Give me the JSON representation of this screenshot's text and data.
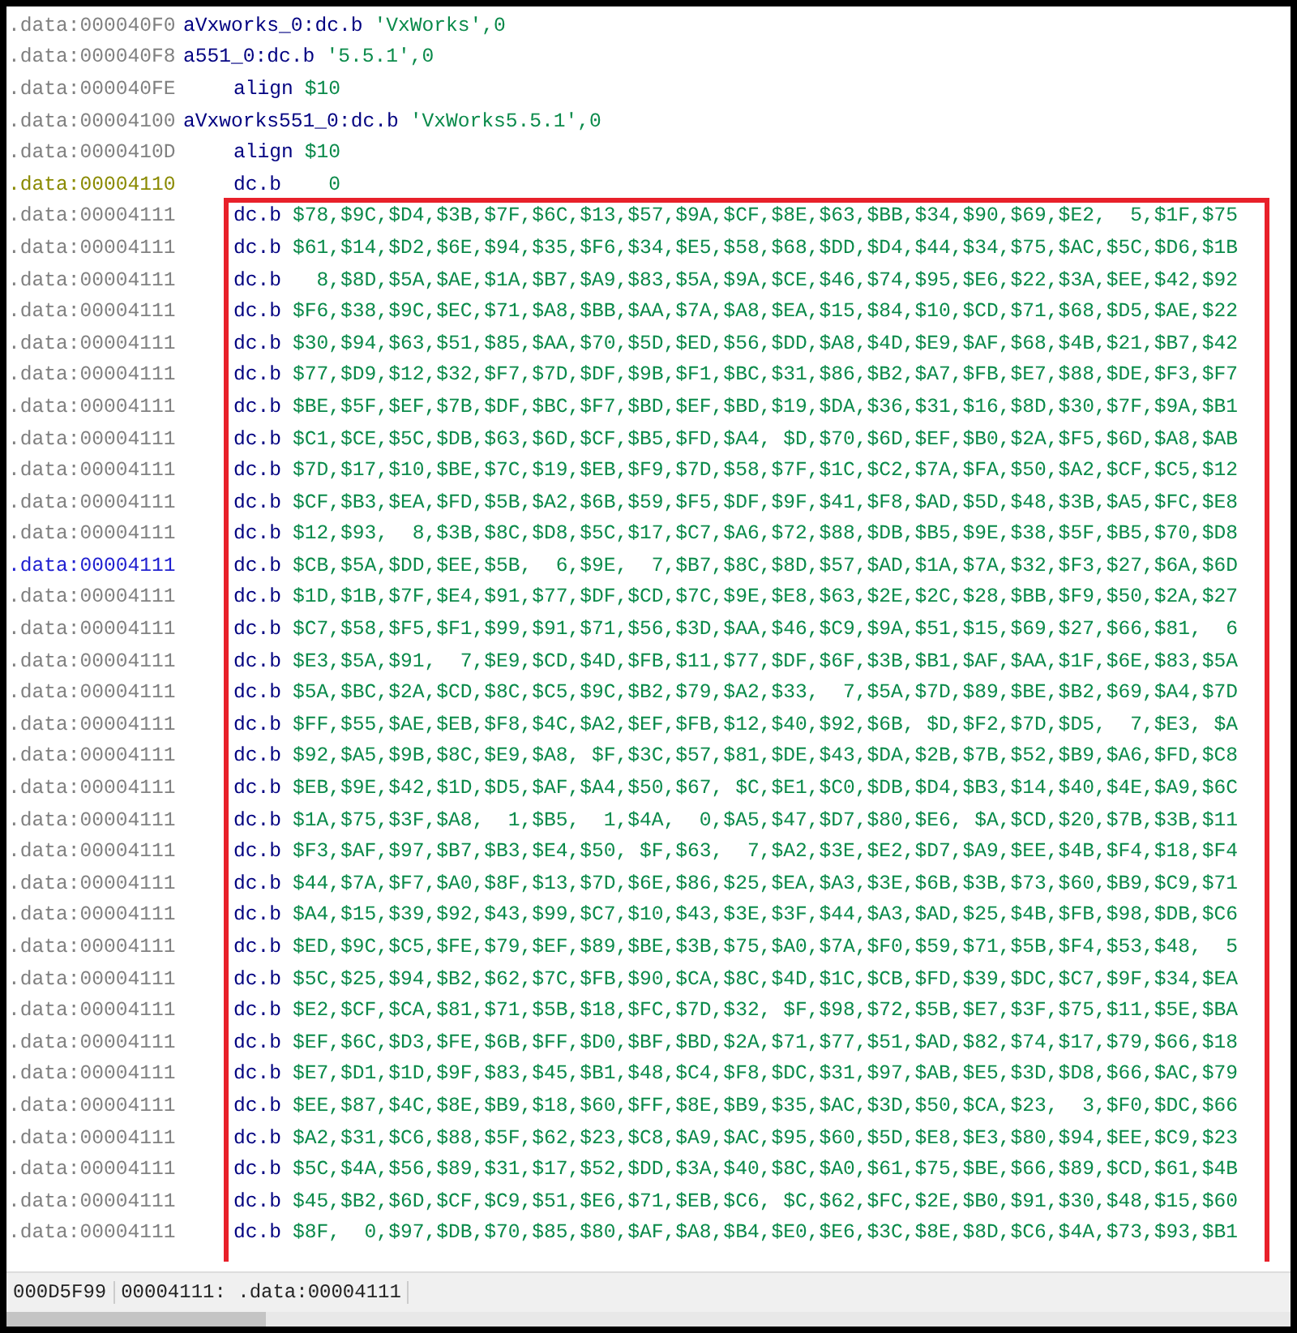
{
  "listing": [
    {
      "address": ".data:000040F0",
      "color": "#808080",
      "label": "aVxworks_0:",
      "mnemonic": "dc.b",
      "operand": "'VxWorks',0"
    },
    {
      "address": ".data:000040F8",
      "color": "#808080",
      "label": "a551_0:",
      "mnemonic": "dc.b",
      "operand": "'5.5.1',0"
    },
    {
      "address": ".data:000040FE",
      "color": "#808080",
      "mnemonic": "align",
      "operand": "$10"
    },
    {
      "address": ".data:00004100",
      "color": "#808080",
      "label": "aVxworks551_0:",
      "mnemonic": "dc.b",
      "operand": "'VxWorks5.5.1',0"
    },
    {
      "address": ".data:0000410D",
      "color": "#808080",
      "mnemonic": "align",
      "operand": "$10"
    },
    {
      "address": ".data:00004110",
      "color": "#8a8a00",
      "mnemonic": "dc.b",
      "operand": "   0"
    },
    {
      "address": ".data:00004111",
      "color": "#808080",
      "mnemonic": "dc.b",
      "operand": "$78,$9C,$D4,$3B,$7F,$6C,$13,$57,$9A,$CF,$8E,$63,$BB,$34,$90,$69,$E2,  5,$1F,$75"
    },
    {
      "address": ".data:00004111",
      "color": "#808080",
      "mnemonic": "dc.b",
      "operand": "$61,$14,$D2,$6E,$94,$35,$F6,$34,$E5,$58,$68,$DD,$D4,$44,$34,$75,$AC,$5C,$D6,$1B"
    },
    {
      "address": ".data:00004111",
      "color": "#808080",
      "mnemonic": "dc.b",
      "operand": "  8,$8D,$5A,$AE,$1A,$B7,$A9,$83,$5A,$9A,$CE,$46,$74,$95,$E6,$22,$3A,$EE,$42,$92"
    },
    {
      "address": ".data:00004111",
      "color": "#808080",
      "mnemonic": "dc.b",
      "operand": "$F6,$38,$9C,$EC,$71,$A8,$BB,$AA,$7A,$A8,$EA,$15,$84,$10,$CD,$71,$68,$D5,$AE,$22"
    },
    {
      "address": ".data:00004111",
      "color": "#808080",
      "mnemonic": "dc.b",
      "operand": "$30,$94,$63,$51,$85,$AA,$70,$5D,$ED,$56,$DD,$A8,$4D,$E9,$AF,$68,$4B,$21,$B7,$42"
    },
    {
      "address": ".data:00004111",
      "color": "#808080",
      "mnemonic": "dc.b",
      "operand": "$77,$D9,$12,$32,$F7,$7D,$DF,$9B,$F1,$BC,$31,$86,$B2,$A7,$FB,$E7,$88,$DE,$F3,$F7"
    },
    {
      "address": ".data:00004111",
      "color": "#808080",
      "mnemonic": "dc.b",
      "operand": "$BE,$5F,$EF,$7B,$DF,$BC,$F7,$BD,$EF,$BD,$19,$DA,$36,$31,$16,$8D,$30,$7F,$9A,$B1"
    },
    {
      "address": ".data:00004111",
      "color": "#808080",
      "mnemonic": "dc.b",
      "operand": "$C1,$CE,$5C,$DB,$63,$6D,$CF,$B5,$FD,$A4, $D,$70,$6D,$EF,$B0,$2A,$F5,$6D,$A8,$AB"
    },
    {
      "address": ".data:00004111",
      "color": "#808080",
      "mnemonic": "dc.b",
      "operand": "$7D,$17,$10,$BE,$7C,$19,$EB,$F9,$7D,$58,$7F,$1C,$C2,$7A,$FA,$50,$A2,$CF,$C5,$12"
    },
    {
      "address": ".data:00004111",
      "color": "#808080",
      "mnemonic": "dc.b",
      "operand": "$CF,$B3,$EA,$FD,$5B,$A2,$6B,$59,$F5,$DF,$9F,$41,$F8,$AD,$5D,$48,$3B,$A5,$FC,$E8"
    },
    {
      "address": ".data:00004111",
      "color": "#808080",
      "mnemonic": "dc.b",
      "operand": "$12,$93,  8,$3B,$8C,$D8,$5C,$17,$C7,$A6,$72,$88,$DB,$B5,$9E,$38,$5F,$B5,$70,$D8"
    },
    {
      "address": ".data:00004111",
      "color": "#2020d0",
      "mnemonic": "dc.b",
      "operand": "$CB,$5A,$DD,$EE,$5B,  6,$9E,  7,$B7,$8C,$8D,$57,$AD,$1A,$7A,$32,$F3,$27,$6A,$6D"
    },
    {
      "address": ".data:00004111",
      "color": "#808080",
      "mnemonic": "dc.b",
      "operand": "$1D,$1B,$7F,$E4,$91,$77,$DF,$CD,$7C,$9E,$E8,$63,$2E,$2C,$28,$BB,$F9,$50,$2A,$27"
    },
    {
      "address": ".data:00004111",
      "color": "#808080",
      "mnemonic": "dc.b",
      "operand": "$C7,$58,$F5,$F1,$99,$91,$71,$56,$3D,$AA,$46,$C9,$9A,$51,$15,$69,$27,$66,$81,  6"
    },
    {
      "address": ".data:00004111",
      "color": "#808080",
      "mnemonic": "dc.b",
      "operand": "$E3,$5A,$91,  7,$E9,$CD,$4D,$FB,$11,$77,$DF,$6F,$3B,$B1,$AF,$AA,$1F,$6E,$83,$5A"
    },
    {
      "address": ".data:00004111",
      "color": "#808080",
      "mnemonic": "dc.b",
      "operand": "$5A,$BC,$2A,$CD,$8C,$C5,$9C,$B2,$79,$A2,$33,  7,$5A,$7D,$89,$BE,$B2,$69,$A4,$7D"
    },
    {
      "address": ".data:00004111",
      "color": "#808080",
      "mnemonic": "dc.b",
      "operand": "$FF,$55,$AE,$EB,$F8,$4C,$A2,$EF,$FB,$12,$40,$92,$6B, $D,$F2,$7D,$D5,  7,$E3, $A"
    },
    {
      "address": ".data:00004111",
      "color": "#808080",
      "mnemonic": "dc.b",
      "operand": "$92,$A5,$9B,$8C,$E9,$A8, $F,$3C,$57,$81,$DE,$43,$DA,$2B,$7B,$52,$B9,$A6,$FD,$C8"
    },
    {
      "address": ".data:00004111",
      "color": "#808080",
      "mnemonic": "dc.b",
      "operand": "$EB,$9E,$42,$1D,$D5,$AF,$A4,$50,$67, $C,$E1,$C0,$DB,$D4,$B3,$14,$40,$4E,$A9,$6C"
    },
    {
      "address": ".data:00004111",
      "color": "#808080",
      "mnemonic": "dc.b",
      "operand": "$1A,$75,$3F,$A8,  1,$B5,  1,$4A,  0,$A5,$47,$D7,$80,$E6, $A,$CD,$20,$7B,$3B,$11"
    },
    {
      "address": ".data:00004111",
      "color": "#808080",
      "mnemonic": "dc.b",
      "operand": "$F3,$AF,$97,$B7,$B3,$E4,$50, $F,$63,  7,$A2,$3E,$E2,$D7,$A9,$EE,$4B,$F4,$18,$F4"
    },
    {
      "address": ".data:00004111",
      "color": "#808080",
      "mnemonic": "dc.b",
      "operand": "$44,$7A,$F7,$A0,$8F,$13,$7D,$6E,$86,$25,$EA,$A3,$3E,$6B,$3B,$73,$60,$B9,$C9,$71"
    },
    {
      "address": ".data:00004111",
      "color": "#808080",
      "mnemonic": "dc.b",
      "operand": "$A4,$15,$39,$92,$43,$99,$C7,$10,$43,$3E,$3F,$44,$A3,$AD,$25,$4B,$FB,$98,$DB,$C6"
    },
    {
      "address": ".data:00004111",
      "color": "#808080",
      "mnemonic": "dc.b",
      "operand": "$ED,$9C,$C5,$FE,$79,$EF,$89,$BE,$3B,$75,$A0,$7A,$F0,$59,$71,$5B,$F4,$53,$48,  5"
    },
    {
      "address": ".data:00004111",
      "color": "#808080",
      "mnemonic": "dc.b",
      "operand": "$5C,$25,$94,$B2,$62,$7C,$FB,$90,$CA,$8C,$4D,$1C,$CB,$FD,$39,$DC,$C7,$9F,$34,$EA"
    },
    {
      "address": ".data:00004111",
      "color": "#808080",
      "mnemonic": "dc.b",
      "operand": "$E2,$CF,$CA,$81,$71,$5B,$18,$FC,$7D,$32, $F,$98,$72,$5B,$E7,$3F,$75,$11,$5E,$BA"
    },
    {
      "address": ".data:00004111",
      "color": "#808080",
      "mnemonic": "dc.b",
      "operand": "$EF,$6C,$D3,$FE,$6B,$FF,$D0,$BF,$BD,$2A,$71,$77,$51,$AD,$82,$74,$17,$79,$66,$18"
    },
    {
      "address": ".data:00004111",
      "color": "#808080",
      "mnemonic": "dc.b",
      "operand": "$E7,$D1,$1D,$9F,$83,$45,$B1,$48,$C4,$F8,$DC,$31,$97,$AB,$E5,$3D,$D8,$66,$AC,$79"
    },
    {
      "address": ".data:00004111",
      "color": "#808080",
      "mnemonic": "dc.b",
      "operand": "$EE,$87,$4C,$8E,$B9,$18,$60,$FF,$8E,$B9,$35,$AC,$3D,$50,$CA,$23,  3,$F0,$DC,$66"
    },
    {
      "address": ".data:00004111",
      "color": "#808080",
      "mnemonic": "dc.b",
      "operand": "$A2,$31,$C6,$88,$5F,$62,$23,$C8,$A9,$AC,$95,$60,$5D,$E8,$E3,$80,$94,$EE,$C9,$23"
    },
    {
      "address": ".data:00004111",
      "color": "#808080",
      "mnemonic": "dc.b",
      "operand": "$5C,$4A,$56,$89,$31,$17,$52,$DD,$3A,$40,$8C,$A0,$61,$75,$BE,$66,$89,$CD,$61,$4B"
    },
    {
      "address": ".data:00004111",
      "color": "#808080",
      "mnemonic": "dc.b",
      "operand": "$45,$B2,$6D,$CF,$C9,$51,$E6,$71,$EB,$C6, $C,$62,$FC,$2E,$B0,$91,$30,$48,$15,$60"
    },
    {
      "address": ".data:00004111",
      "color": "#808080",
      "mnemonic": "dc.b",
      "operand": "$8F,  0,$97,$DB,$70,$85,$80,$AF,$A8,$B4,$E0,$E6,$3C,$8E,$8D,$C6,$4A,$73,$93,$B1"
    }
  ],
  "status_bar": {
    "offset": "000D5F99",
    "location": "00004111: .data:00004111"
  }
}
